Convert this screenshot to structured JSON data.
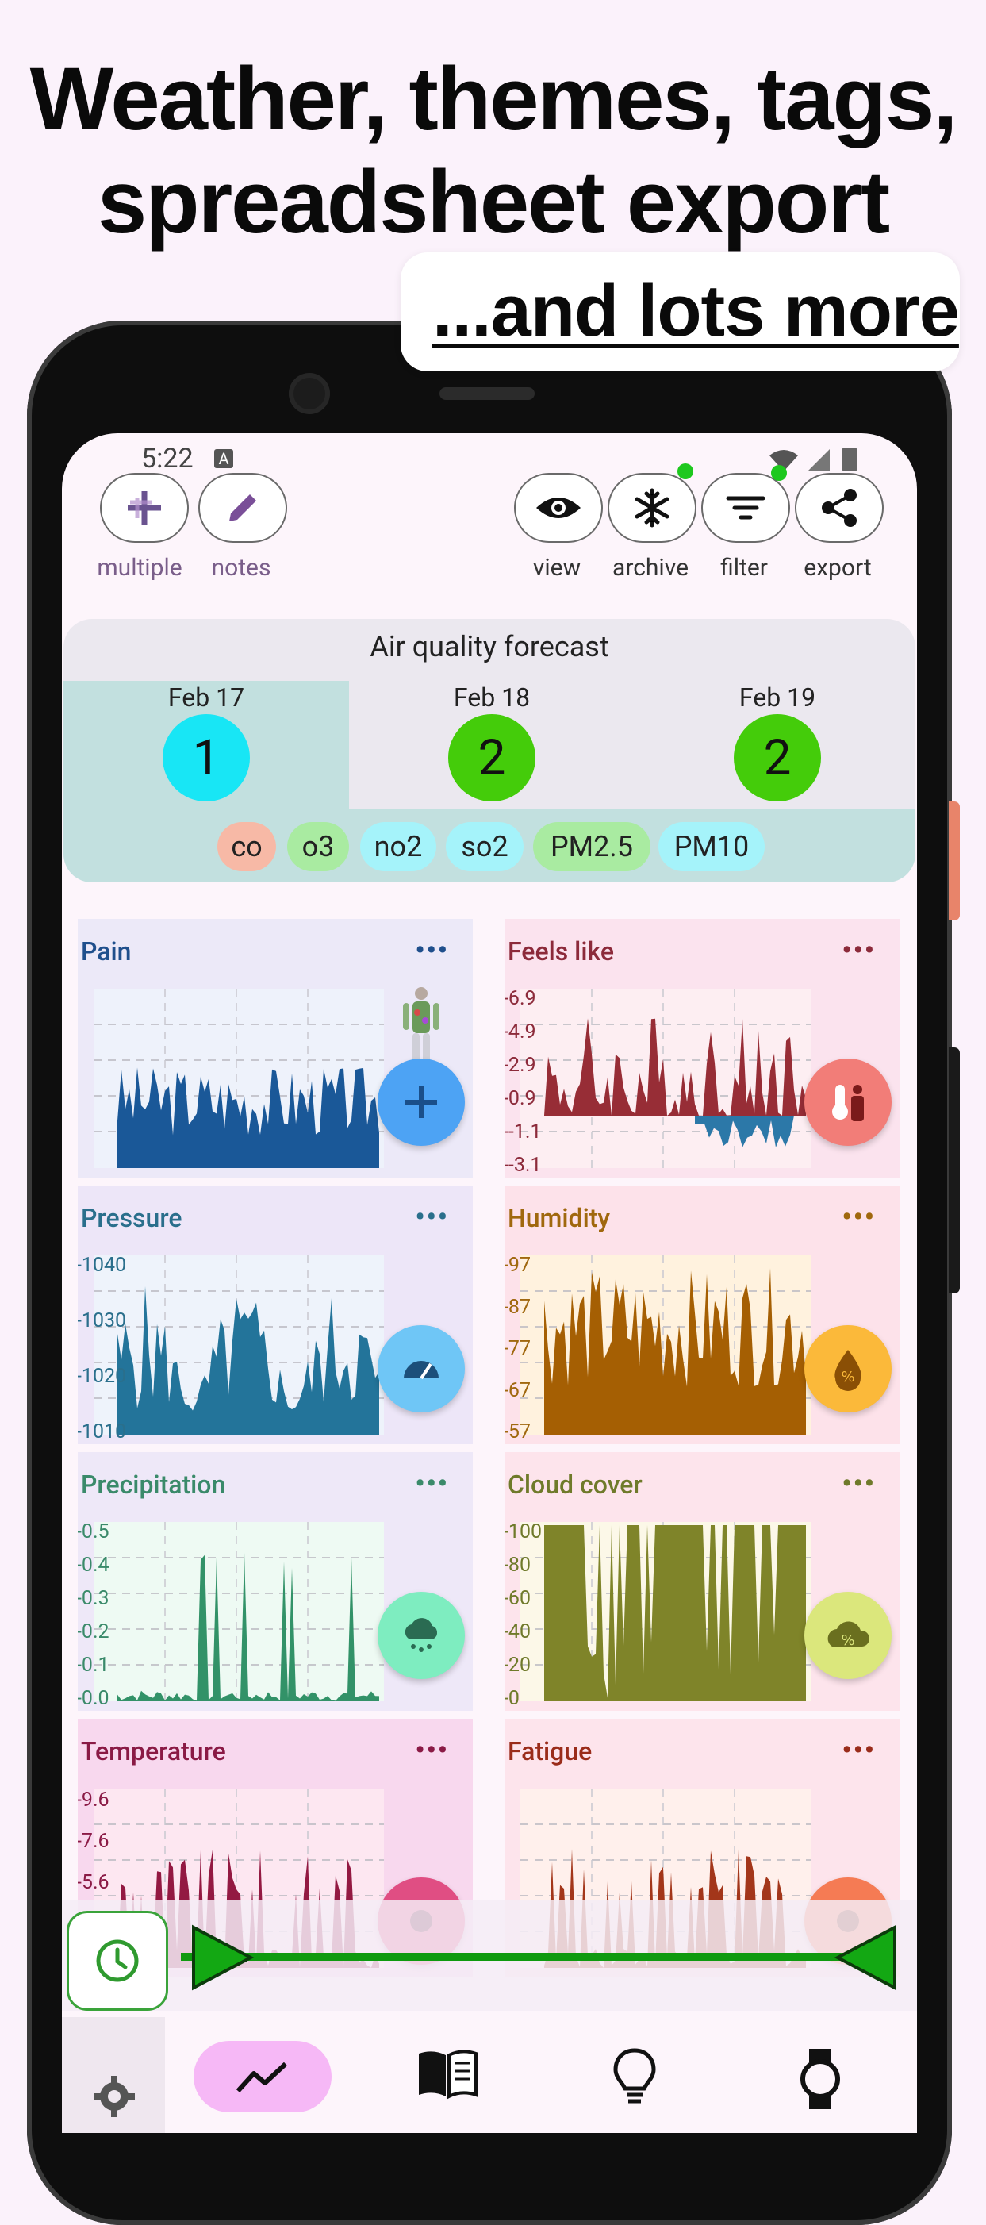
{
  "promo": {
    "headline_line1": "Weather, themes, tags,",
    "headline_line2": "spreadsheet export",
    "subheadline": "...and lots more"
  },
  "status_bar": {
    "time": "5:22",
    "notification_glyph": "A"
  },
  "toolbar": {
    "left": [
      {
        "label": "multiple",
        "icon": "multi-add-icon"
      },
      {
        "label": "notes",
        "icon": "pencil-icon"
      }
    ],
    "right": [
      {
        "label": "view",
        "icon": "eye-icon"
      },
      {
        "label": "archive",
        "icon": "snowflake-icon"
      },
      {
        "label": "filter",
        "icon": "filter-icon"
      },
      {
        "label": "export",
        "icon": "share-icon"
      }
    ]
  },
  "air_quality": {
    "title": "Air quality forecast",
    "days": [
      {
        "date": "Feb 17",
        "index": "1",
        "color": "#18e6f5",
        "selected": true
      },
      {
        "date": "Feb 18",
        "index": "2",
        "color": "#44cc0a",
        "selected": false
      },
      {
        "date": "Feb 19",
        "index": "2",
        "color": "#44cc0a",
        "selected": false
      }
    ],
    "pollutants": [
      {
        "label": "co",
        "color": "#f7b9a6"
      },
      {
        "label": "o3",
        "color": "#a9eba1"
      },
      {
        "label": "no2",
        "color": "#a5f3fa"
      },
      {
        "label": "so2",
        "color": "#a5f3fa"
      },
      {
        "label": "PM2.5",
        "color": "#a9eba1"
      },
      {
        "label": "PM10",
        "color": "#a5f3fa"
      }
    ]
  },
  "cards": [
    {
      "title": "Pain",
      "more": "•••",
      "title_color": "#1f4f8c",
      "bg": "#ece9f8",
      "plot_bg": "#eef2fb",
      "fill": "#1a5898",
      "fab_color": "#4da3f4",
      "fab_icon": "plus-icon",
      "y_labels": [],
      "body_icon": "body-map-icon"
    },
    {
      "title": "Feels like",
      "more": "•••",
      "title_color": "#8c2a3a",
      "bg": "#fbe3ee",
      "plot_bg": "#fdeef2",
      "fill": "#972d36",
      "fill2": "#2c78a8",
      "fab_color": "#f27d78",
      "fab_icon": "thermometer-person-icon",
      "y_labels": [
        "-6.9",
        "-4.9",
        "-2.9",
        "-0.9",
        "--1.1",
        "--3.1"
      ]
    },
    {
      "title": "Pressure",
      "more": "•••",
      "title_color": "#2a6f8c",
      "bg": "#ede6f8",
      "plot_bg": "#eef3fb",
      "fill": "#23749a",
      "fab_color": "#6fc6f6",
      "fab_icon": "gauge-icon",
      "y_labels": [
        "-1040",
        "-1030",
        "-1020",
        "-1010"
      ]
    },
    {
      "title": "Humidity",
      "more": "•••",
      "title_color": "#a0680e",
      "bg": "#fde2ea",
      "plot_bg": "#fff2de",
      "fill": "#a55f03",
      "fab_color": "#fbb93a",
      "fab_icon": "humidity-drop-icon",
      "y_labels": [
        "-97",
        "-87",
        "-77",
        "-67",
        "-57"
      ]
    },
    {
      "title": "Precipitation",
      "more": "•••",
      "title_color": "#3a8a6a",
      "bg": "#eee8f8",
      "plot_bg": "#eefaf3",
      "fill": "#329268",
      "fab_color": "#7eedc0",
      "fab_icon": "snow-cloud-icon",
      "y_labels": [
        "-0.5",
        "-0.4",
        "-0.3",
        "-0.2",
        "-0.1",
        "-0.0"
      ]
    },
    {
      "title": "Cloud cover",
      "more": "•••",
      "title_color": "#6f7a2a",
      "bg": "#fde4ec",
      "plot_bg": "#fcf8e8",
      "fill": "#7f8429",
      "fab_color": "#dbe77c",
      "fab_icon": "cloud-percent-icon",
      "y_labels": [
        "-100",
        "-80",
        "-60",
        "-40",
        "-20",
        "-0"
      ]
    },
    {
      "title": "Temperature",
      "more": "•••",
      "title_color": "#8a1a45",
      "bg": "#f8d8ee",
      "plot_bg": "#fde7f1",
      "fill": "#931942",
      "fab_color": "#e04e83",
      "fab_icon": "temperature-icon",
      "y_labels": [
        "-9.6",
        "-7.6",
        "-5.6"
      ]
    },
    {
      "title": "Fatigue",
      "more": "•••",
      "title_color": "#9a2c1a",
      "bg": "#fde4ec",
      "plot_bg": "#fff0ec",
      "fill": "#a3361a",
      "fab_color": "#f57b54",
      "fab_icon": "fatigue-icon",
      "y_labels": []
    }
  ],
  "bottom_nav": [
    {
      "icon": "gear-icon"
    },
    {
      "icon": "trend-chart-icon",
      "active": true
    },
    {
      "icon": "book-icon"
    },
    {
      "icon": "lightbulb-icon"
    },
    {
      "icon": "watch-icon"
    }
  ]
}
